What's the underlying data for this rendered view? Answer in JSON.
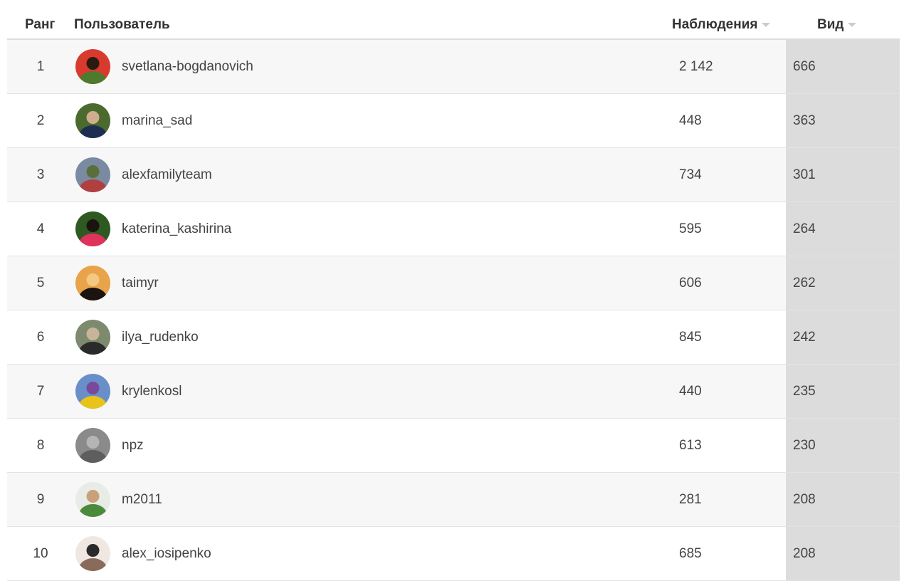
{
  "headers": {
    "rank": "Ранг",
    "user": "Пользователь",
    "observations": "Наблюдения",
    "species": "Вид"
  },
  "rows": [
    {
      "rank": "1",
      "user": "svetlana-bogdanovich",
      "observations": "2 142",
      "species": "666",
      "avatar_colors": [
        "#d83a2e",
        "#4d7a2e",
        "#2b1a12"
      ]
    },
    {
      "rank": "2",
      "user": "marina_sad",
      "observations": "448",
      "species": "363",
      "avatar_colors": [
        "#4a6b2d",
        "#1e2e52",
        "#cfae8e"
      ]
    },
    {
      "rank": "3",
      "user": "alexfamilyteam",
      "observations": "734",
      "species": "301",
      "avatar_colors": [
        "#7a8aa0",
        "#b04040",
        "#5a6e3a"
      ]
    },
    {
      "rank": "4",
      "user": "katerina_kashirina",
      "observations": "595",
      "species": "264",
      "avatar_colors": [
        "#2e5a22",
        "#e0325a",
        "#1a1410"
      ]
    },
    {
      "rank": "5",
      "user": "taimyr",
      "observations": "606",
      "species": "262",
      "avatar_colors": [
        "#e9a34a",
        "#1a1310",
        "#f3c982"
      ]
    },
    {
      "rank": "6",
      "user": "ilya_rudenko",
      "observations": "845",
      "species": "242",
      "avatar_colors": [
        "#7d8a6e",
        "#2a2a2a",
        "#c9b49a"
      ]
    },
    {
      "rank": "7",
      "user": "krylenkosl",
      "observations": "440",
      "species": "235",
      "avatar_colors": [
        "#6a8ec8",
        "#e8c31a",
        "#7a4a9a"
      ]
    },
    {
      "rank": "8",
      "user": "npz",
      "observations": "613",
      "species": "230",
      "avatar_colors": [
        "#8a8a8a",
        "#5e5e5e",
        "#b5b5b5"
      ]
    },
    {
      "rank": "9",
      "user": "m2011",
      "observations": "281",
      "species": "208",
      "avatar_colors": [
        "#e8ece6",
        "#4a8a3a",
        "#c9a07a"
      ]
    },
    {
      "rank": "10",
      "user": "alex_iosipenko",
      "observations": "685",
      "species": "208",
      "avatar_colors": [
        "#efe8e2",
        "#8a6a5a",
        "#2a2a2a"
      ]
    }
  ]
}
